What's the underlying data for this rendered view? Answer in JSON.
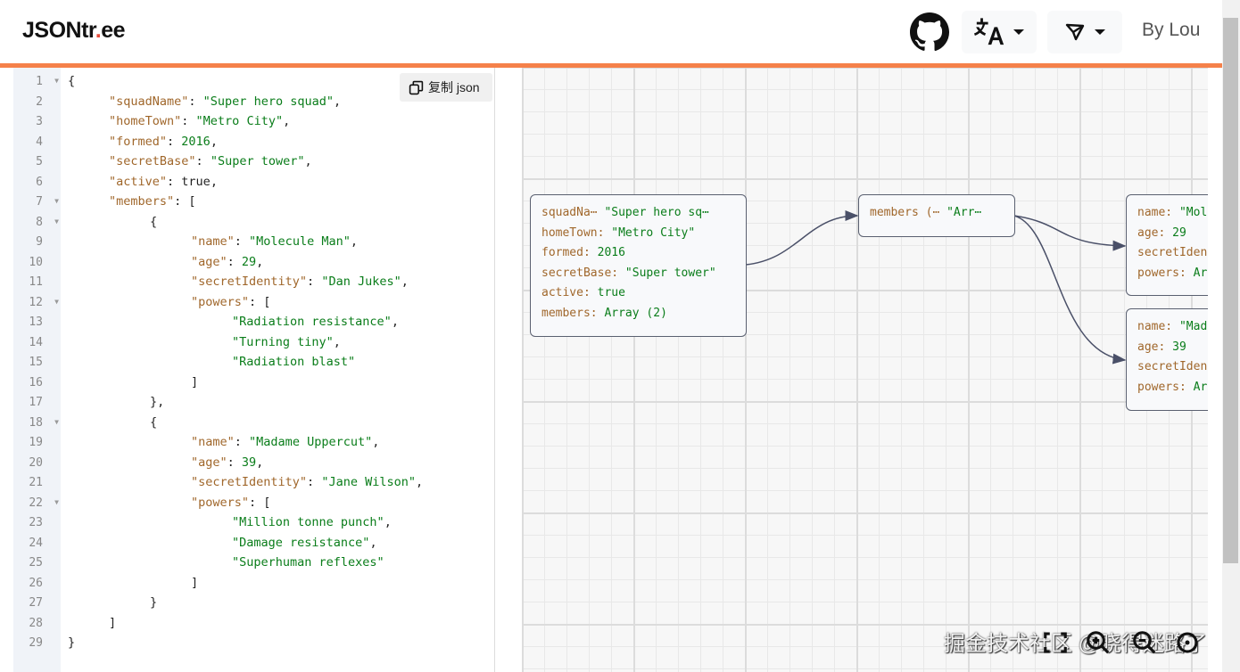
{
  "header": {
    "logo_pre": "JSONtr",
    "logo_dot": ".",
    "logo_post": "ee",
    "by": "By Lou",
    "icons": [
      "github-icon",
      "translate-icon",
      "send-icon"
    ]
  },
  "editor": {
    "copy_label": "复制 json",
    "lines": [
      {
        "i": 0,
        "f": true,
        "t": [
          [
            "{",
            "p"
          ]
        ]
      },
      {
        "i": 1,
        "t": [
          [
            "\"squadName\"",
            "k"
          ],
          [
            ": ",
            "p"
          ],
          [
            "\"Super hero squad\"",
            "s"
          ],
          [
            ",",
            "p"
          ]
        ]
      },
      {
        "i": 1,
        "t": [
          [
            "\"homeTown\"",
            "k"
          ],
          [
            ": ",
            "p"
          ],
          [
            "\"Metro City\"",
            "s"
          ],
          [
            ",",
            "p"
          ]
        ]
      },
      {
        "i": 1,
        "t": [
          [
            "\"formed\"",
            "k"
          ],
          [
            ": ",
            "p"
          ],
          [
            "2016",
            "v"
          ],
          [
            ",",
            "p"
          ]
        ]
      },
      {
        "i": 1,
        "t": [
          [
            "\"secretBase\"",
            "k"
          ],
          [
            ": ",
            "p"
          ],
          [
            "\"Super tower\"",
            "s"
          ],
          [
            ",",
            "p"
          ]
        ]
      },
      {
        "i": 1,
        "t": [
          [
            "\"active\"",
            "k"
          ],
          [
            ": ",
            "p"
          ],
          [
            "true",
            "p"
          ],
          [
            ",",
            "p"
          ]
        ]
      },
      {
        "i": 1,
        "f": true,
        "t": [
          [
            "\"members\"",
            "k"
          ],
          [
            ": [",
            "p"
          ]
        ]
      },
      {
        "i": 2,
        "f": true,
        "t": [
          [
            "{",
            "p"
          ]
        ]
      },
      {
        "i": 3,
        "t": [
          [
            "\"name\"",
            "k"
          ],
          [
            ": ",
            "p"
          ],
          [
            "\"Molecule Man\"",
            "s"
          ],
          [
            ",",
            "p"
          ]
        ]
      },
      {
        "i": 3,
        "t": [
          [
            "\"age\"",
            "k"
          ],
          [
            ": ",
            "p"
          ],
          [
            "29",
            "v"
          ],
          [
            ",",
            "p"
          ]
        ]
      },
      {
        "i": 3,
        "t": [
          [
            "\"secretIdentity\"",
            "k"
          ],
          [
            ": ",
            "p"
          ],
          [
            "\"Dan Jukes\"",
            "s"
          ],
          [
            ",",
            "p"
          ]
        ]
      },
      {
        "i": 3,
        "f": true,
        "t": [
          [
            "\"powers\"",
            "k"
          ],
          [
            ": [",
            "p"
          ]
        ]
      },
      {
        "i": 4,
        "t": [
          [
            "\"Radiation resistance\"",
            "s"
          ],
          [
            ",",
            "p"
          ]
        ]
      },
      {
        "i": 4,
        "t": [
          [
            "\"Turning tiny\"",
            "s"
          ],
          [
            ",",
            "p"
          ]
        ]
      },
      {
        "i": 4,
        "t": [
          [
            "\"Radiation blast\"",
            "s"
          ]
        ]
      },
      {
        "i": 3,
        "t": [
          [
            "]",
            "p"
          ]
        ]
      },
      {
        "i": 2,
        "t": [
          [
            "},",
            "p"
          ]
        ]
      },
      {
        "i": 2,
        "f": true,
        "t": [
          [
            "{",
            "p"
          ]
        ]
      },
      {
        "i": 3,
        "t": [
          [
            "\"name\"",
            "k"
          ],
          [
            ": ",
            "p"
          ],
          [
            "\"Madame Uppercut\"",
            "s"
          ],
          [
            ",",
            "p"
          ]
        ]
      },
      {
        "i": 3,
        "t": [
          [
            "\"age\"",
            "k"
          ],
          [
            ": ",
            "p"
          ],
          [
            "39",
            "v"
          ],
          [
            ",",
            "p"
          ]
        ]
      },
      {
        "i": 3,
        "t": [
          [
            "\"secretIdentity\"",
            "k"
          ],
          [
            ": ",
            "p"
          ],
          [
            "\"Jane Wilson\"",
            "s"
          ],
          [
            ",",
            "p"
          ]
        ]
      },
      {
        "i": 3,
        "f": true,
        "t": [
          [
            "\"powers\"",
            "k"
          ],
          [
            ": [",
            "p"
          ]
        ]
      },
      {
        "i": 4,
        "t": [
          [
            "\"Million tonne punch\"",
            "s"
          ],
          [
            ",",
            "p"
          ]
        ]
      },
      {
        "i": 4,
        "t": [
          [
            "\"Damage resistance\"",
            "s"
          ],
          [
            ",",
            "p"
          ]
        ]
      },
      {
        "i": 4,
        "t": [
          [
            "\"Superhuman reflexes\"",
            "s"
          ]
        ]
      },
      {
        "i": 3,
        "t": [
          [
            "]",
            "p"
          ]
        ]
      },
      {
        "i": 2,
        "t": [
          [
            "}",
            "p"
          ]
        ]
      },
      {
        "i": 1,
        "t": [
          [
            "]",
            "p"
          ]
        ]
      },
      {
        "i": 0,
        "t": [
          [
            "}",
            "p"
          ]
        ]
      }
    ]
  },
  "graph": {
    "nodes": [
      {
        "rows": [
          [
            "squadNa⋯ ",
            "\"Super hero sq⋯"
          ],
          [
            "homeTown: ",
            "\"Metro City\""
          ],
          [
            "formed: ",
            "2016"
          ],
          [
            "secretBase: ",
            "\"Super tower\""
          ],
          [
            "active: ",
            "true"
          ],
          [
            "members: ",
            "Array (2)"
          ]
        ]
      },
      {
        "rows": [
          [
            "members (⋯ ",
            "\"Arr⋯"
          ]
        ]
      },
      {
        "rows": [
          [
            "name: ",
            "\"Mol"
          ],
          [
            "age: ",
            "29"
          ],
          [
            "secretIden",
            ""
          ],
          [
            "powers: ",
            "Ar"
          ]
        ]
      },
      {
        "rows": [
          [
            "name: ",
            "\"Mad"
          ],
          [
            "age: ",
            "39"
          ],
          [
            "secretIden",
            ""
          ],
          [
            "powers: ",
            "Ar"
          ]
        ]
      }
    ],
    "controls": [
      "fullscreen-icon",
      "zoom-in-icon",
      "zoom-out-icon",
      "reset-icon"
    ]
  },
  "watermark": "掘金技术社区 @晓得迷路了",
  "colors": {
    "accent": "#f5814a",
    "key": "#a0672b",
    "string": "#0a7d1a"
  }
}
